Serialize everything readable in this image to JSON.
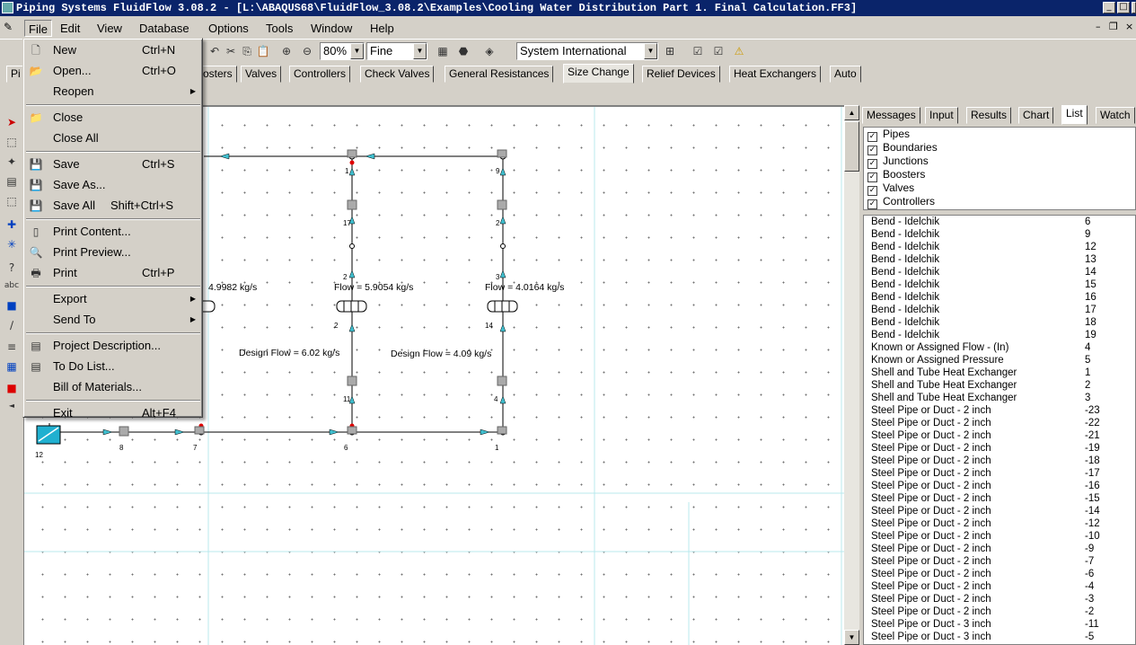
{
  "window": {
    "title": "Piping Systems FluidFlow 3.08.2 - [L:\\ABAQUS68\\FluidFlow_3.08.2\\Examples\\Cooling Water Distribution Part 1. Final Calculation.FF3]",
    "min": "_",
    "max": "□",
    "close": "×"
  },
  "menubar": {
    "items": [
      "File",
      "Edit",
      "View",
      "Database",
      "Options",
      "Tools",
      "Window",
      "Help"
    ],
    "mdi_min": "–",
    "mdi_restore": "❐",
    "mdi_close": "×"
  },
  "toolbar": {
    "zoom": "80%",
    "detail": "Fine",
    "units": "System International"
  },
  "palette_tabs": [
    "Pi",
    "osters",
    "Valves",
    "Controllers",
    "Check Valves",
    "General Resistances",
    "Size Change",
    "Relief Devices",
    "Heat Exchangers",
    "Auto"
  ],
  "selected_palette_tab": "Size Change",
  "file_menu": [
    {
      "label": "New",
      "shortcut": "Ctrl+N",
      "icon": "new-file-icon",
      "glyph": "🗋"
    },
    {
      "label": "Open...",
      "shortcut": "Ctrl+O",
      "icon": "open-folder-icon",
      "glyph": "📂"
    },
    {
      "label": "Reopen",
      "shortcut": "",
      "submenu": true
    },
    {
      "sep": true
    },
    {
      "label": "Close",
      "shortcut": "",
      "icon": "close-folder-icon",
      "glyph": "📁"
    },
    {
      "label": "Close All",
      "shortcut": ""
    },
    {
      "sep": true
    },
    {
      "label": "Save",
      "shortcut": "Ctrl+S",
      "icon": "save-icon",
      "glyph": "💾"
    },
    {
      "label": "Save As...",
      "shortcut": "",
      "icon": "save-as-icon",
      "glyph": "💾"
    },
    {
      "label": "Save All",
      "shortcut": "Shift+Ctrl+S",
      "icon": "save-all-icon",
      "glyph": "💾"
    },
    {
      "sep": true
    },
    {
      "label": "Print Content...",
      "shortcut": "",
      "icon": "print-content-icon",
      "glyph": "▯"
    },
    {
      "label": "Print Preview...",
      "shortcut": "",
      "icon": "print-preview-icon",
      "glyph": "🔍"
    },
    {
      "label": "Print",
      "shortcut": "Ctrl+P",
      "icon": "printer-icon",
      "glyph": "🖶"
    },
    {
      "sep": true
    },
    {
      "label": "Export",
      "shortcut": "",
      "submenu": true
    },
    {
      "label": "Send To",
      "shortcut": "",
      "submenu": true
    },
    {
      "sep": true
    },
    {
      "label": "Project Description...",
      "shortcut": "",
      "icon": "project-description-icon",
      "glyph": "▤"
    },
    {
      "label": "To Do List...",
      "shortcut": "",
      "icon": "todo-list-icon",
      "glyph": "▤"
    },
    {
      "label": "Bill of Materials...",
      "shortcut": ""
    },
    {
      "sep": true
    },
    {
      "label": "Exit",
      "shortcut": "Alt+F4"
    }
  ],
  "right_panel": {
    "tabs": [
      "Messages",
      "Input",
      "Results",
      "Chart",
      "List",
      "Watch"
    ],
    "selected_tab": "List",
    "filters": [
      {
        "label": "Pipes",
        "checked": true
      },
      {
        "label": "Boundaries",
        "checked": true
      },
      {
        "label": "Junctions",
        "checked": true
      },
      {
        "label": "Boosters",
        "checked": true
      },
      {
        "label": "Valves",
        "checked": true
      },
      {
        "label": "Controllers",
        "checked": true
      }
    ],
    "check_mark": "✓",
    "list": [
      {
        "name": "Bend - Idelchik",
        "id": "6"
      },
      {
        "name": "Bend - Idelchik",
        "id": "9"
      },
      {
        "name": "Bend - Idelchik",
        "id": "12"
      },
      {
        "name": "Bend - Idelchik",
        "id": "13"
      },
      {
        "name": "Bend - Idelchik",
        "id": "14"
      },
      {
        "name": "Bend - Idelchik",
        "id": "15"
      },
      {
        "name": "Bend - Idelchik",
        "id": "16"
      },
      {
        "name": "Bend - Idelchik",
        "id": "17"
      },
      {
        "name": "Bend - Idelchik",
        "id": "18"
      },
      {
        "name": "Bend - Idelchik",
        "id": "19"
      },
      {
        "name": "Known or Assigned Flow - (In)",
        "id": "4"
      },
      {
        "name": "Known or Assigned Pressure",
        "id": "5"
      },
      {
        "name": "Shell and Tube Heat Exchanger",
        "id": "1"
      },
      {
        "name": "Shell and Tube Heat Exchanger",
        "id": "2"
      },
      {
        "name": "Shell and Tube Heat Exchanger",
        "id": "3"
      },
      {
        "name": "Steel Pipe or Duct - 2 inch",
        "id": "-23"
      },
      {
        "name": "Steel Pipe or Duct - 2 inch",
        "id": "-22"
      },
      {
        "name": "Steel Pipe or Duct - 2 inch",
        "id": "-21"
      },
      {
        "name": "Steel Pipe or Duct - 2 inch",
        "id": "-19"
      },
      {
        "name": "Steel Pipe or Duct - 2 inch",
        "id": "-18"
      },
      {
        "name": "Steel Pipe or Duct - 2 inch",
        "id": "-17"
      },
      {
        "name": "Steel Pipe or Duct - 2 inch",
        "id": "-16"
      },
      {
        "name": "Steel Pipe or Duct - 2 inch",
        "id": "-15"
      },
      {
        "name": "Steel Pipe or Duct - 2 inch",
        "id": "-14"
      },
      {
        "name": "Steel Pipe or Duct - 2 inch",
        "id": "-12"
      },
      {
        "name": "Steel Pipe or Duct - 2 inch",
        "id": "-10"
      },
      {
        "name": "Steel Pipe or Duct - 2 inch",
        "id": "-9"
      },
      {
        "name": "Steel Pipe or Duct - 2 inch",
        "id": "-7"
      },
      {
        "name": "Steel Pipe or Duct - 2 inch",
        "id": "-6"
      },
      {
        "name": "Steel Pipe or Duct - 2 inch",
        "id": "-4"
      },
      {
        "name": "Steel Pipe or Duct - 2 inch",
        "id": "-3"
      },
      {
        "name": "Steel Pipe or Duct - 2 inch",
        "id": "-2"
      },
      {
        "name": "Steel Pipe or Duct - 3 inch",
        "id": "-11"
      },
      {
        "name": "Steel Pipe or Duct - 3 inch",
        "id": "-5"
      }
    ]
  },
  "diagram": {
    "flow_1": "4.9982 kg/s",
    "flow_2": "Flow = 5.9054 kg/s",
    "flow_3": "Flow = 4.0164 kg/s",
    "design_flow_2": "Design Flow = 6.02 kg/s",
    "design_flow_3": "Design Flow = 4.09 kg/s",
    "node_labels": [
      "1",
      "9",
      "17",
      "2",
      "2",
      "3",
      "2",
      "14",
      "11",
      "4",
      "12",
      "8",
      "7",
      "6",
      "1",
      "1",
      "1"
    ]
  },
  "colors": {
    "titlebar": "#0a246a",
    "pipe": "#000000",
    "arrow": "#40c0d0",
    "junction_red": "#e00000",
    "boundary": "#20b0d0"
  }
}
